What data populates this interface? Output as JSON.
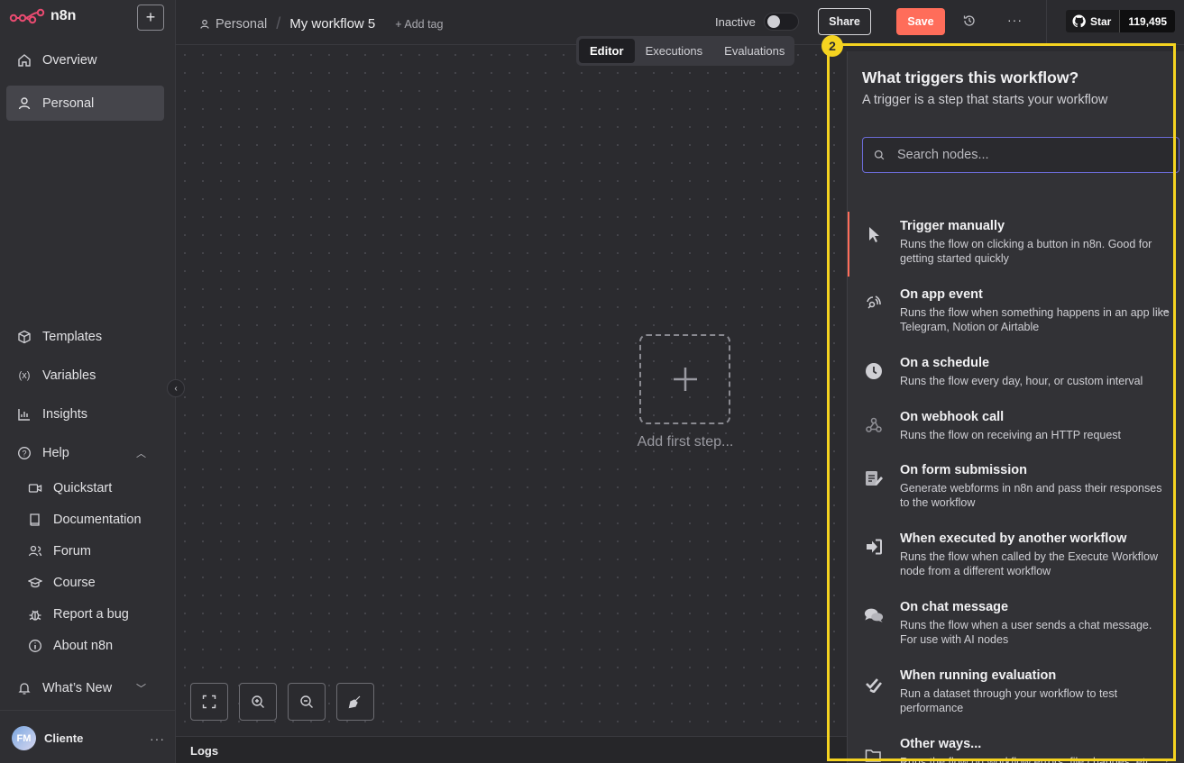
{
  "brand": {
    "name": "n8n"
  },
  "sidebar": {
    "new_label": "+",
    "top_items": [
      {
        "label": "Overview",
        "icon": "home-icon"
      },
      {
        "label": "Personal",
        "icon": "user-icon",
        "active": true
      }
    ],
    "bottom_items": [
      {
        "label": "Templates",
        "icon": "box-icon"
      },
      {
        "label": "Variables",
        "icon": "variable-icon"
      },
      {
        "label": "Insights",
        "icon": "chart-icon"
      },
      {
        "label": "Help",
        "icon": "help-icon"
      }
    ],
    "help_items": [
      {
        "label": "Quickstart",
        "icon": "video-icon"
      },
      {
        "label": "Documentation",
        "icon": "book-icon"
      },
      {
        "label": "Forum",
        "icon": "users-icon"
      },
      {
        "label": "Course",
        "icon": "graduation-icon"
      },
      {
        "label": "Report a bug",
        "icon": "bug-icon"
      },
      {
        "label": "About n8n",
        "icon": "info-icon"
      }
    ],
    "whats_new": "What’s New",
    "user": {
      "initials": "FM",
      "name": "Cliente",
      "more": "···"
    }
  },
  "header": {
    "breadcrumb_personal": "Personal",
    "workflow_name": "My workflow 5",
    "add_tag": "+ Add tag",
    "status": "Inactive",
    "share": "Share",
    "save": "Save",
    "more": "···",
    "github_star": "Star",
    "github_count": "119,495"
  },
  "tabs": [
    "Editor",
    "Executions",
    "Evaluations"
  ],
  "canvas": {
    "add_first_step": "Add first step..."
  },
  "logs": {
    "label": "Logs"
  },
  "panel": {
    "title": "What triggers this workflow?",
    "subtitle": "A trigger is a step that starts your workflow",
    "search_placeholder": "Search nodes...",
    "items": [
      {
        "title": "Trigger manually",
        "desc": "Runs the flow on clicking a button in n8n. Good for getting started quickly",
        "icon": "cursor-icon",
        "selected": true,
        "arrow": false
      },
      {
        "title": "On app event",
        "desc": "Runs the flow when something happens in an app like Telegram, Notion or Airtable",
        "icon": "app-event-icon",
        "arrow": true
      },
      {
        "title": "On a schedule",
        "desc": "Runs the flow every day, hour, or custom interval",
        "icon": "clock-icon",
        "arrow": false
      },
      {
        "title": "On webhook call",
        "desc": "Runs the flow on receiving an HTTP request",
        "icon": "webhook-icon",
        "arrow": false
      },
      {
        "title": "On form submission",
        "desc": "Generate webforms in n8n and pass their responses to the workflow",
        "icon": "form-icon",
        "arrow": false
      },
      {
        "title": "When executed by another workflow",
        "desc": "Runs the flow when called by the Execute Workflow node from a different workflow",
        "icon": "sign-in-icon",
        "arrow": false
      },
      {
        "title": "On chat message",
        "desc": "Runs the flow when a user sends a chat message. For use with AI nodes",
        "icon": "chat-icon",
        "arrow": false
      },
      {
        "title": "When running evaluation",
        "desc": "Run a dataset through your workflow to test performance",
        "icon": "check-double-icon",
        "arrow": false
      },
      {
        "title": "Other ways...",
        "desc": "Runs the flow on workflow errors, file changes, etc.",
        "icon": "folder-icon",
        "arrow": true
      }
    ]
  },
  "annotation": {
    "badge": "2",
    "color": "#f5d320"
  }
}
